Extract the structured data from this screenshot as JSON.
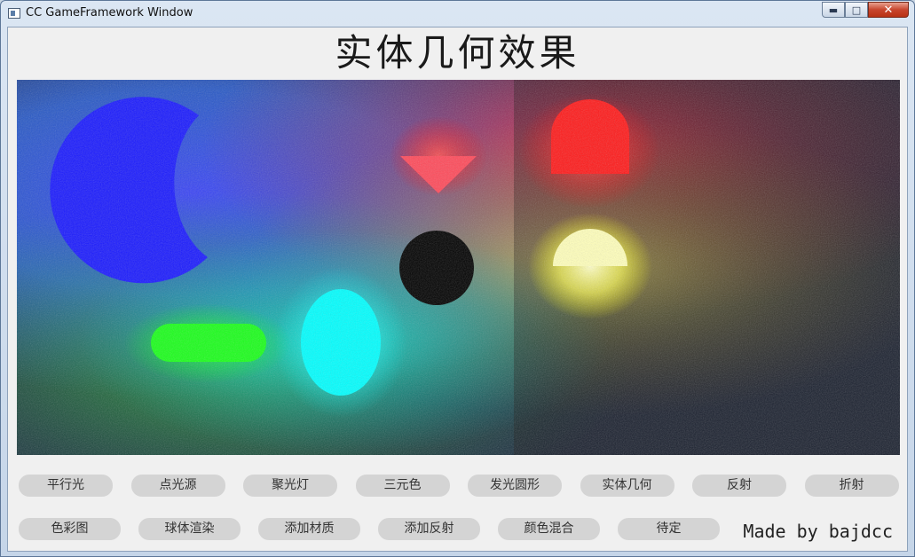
{
  "window": {
    "title": "CC GameFramework Window",
    "minimize_glyph": "▬",
    "maximize_glyph": "□",
    "close_glyph": "✕"
  },
  "header": {
    "title": "实体几何效果"
  },
  "toolbar_row1": [
    {
      "label": "平行光"
    },
    {
      "label": "点光源"
    },
    {
      "label": "聚光灯"
    },
    {
      "label": "三元色"
    },
    {
      "label": "发光圆形"
    },
    {
      "label": "实体几何"
    },
    {
      "label": "反射"
    },
    {
      "label": "折射"
    }
  ],
  "toolbar_row2": [
    {
      "label": "色彩图"
    },
    {
      "label": "球体渲染"
    },
    {
      "label": "添加材质"
    },
    {
      "label": "添加反射"
    },
    {
      "label": "颜色混合"
    },
    {
      "label": "待定"
    }
  ],
  "footer": {
    "credit": "Made by bajdcc"
  },
  "colors": {
    "blue_light": "#1a1aff",
    "red_light": "#ff1a1a",
    "green_light": "#1aff1a",
    "cyan_light": "#00ffff",
    "yellow_light": "#ffff99",
    "black_disk": "#000000"
  }
}
